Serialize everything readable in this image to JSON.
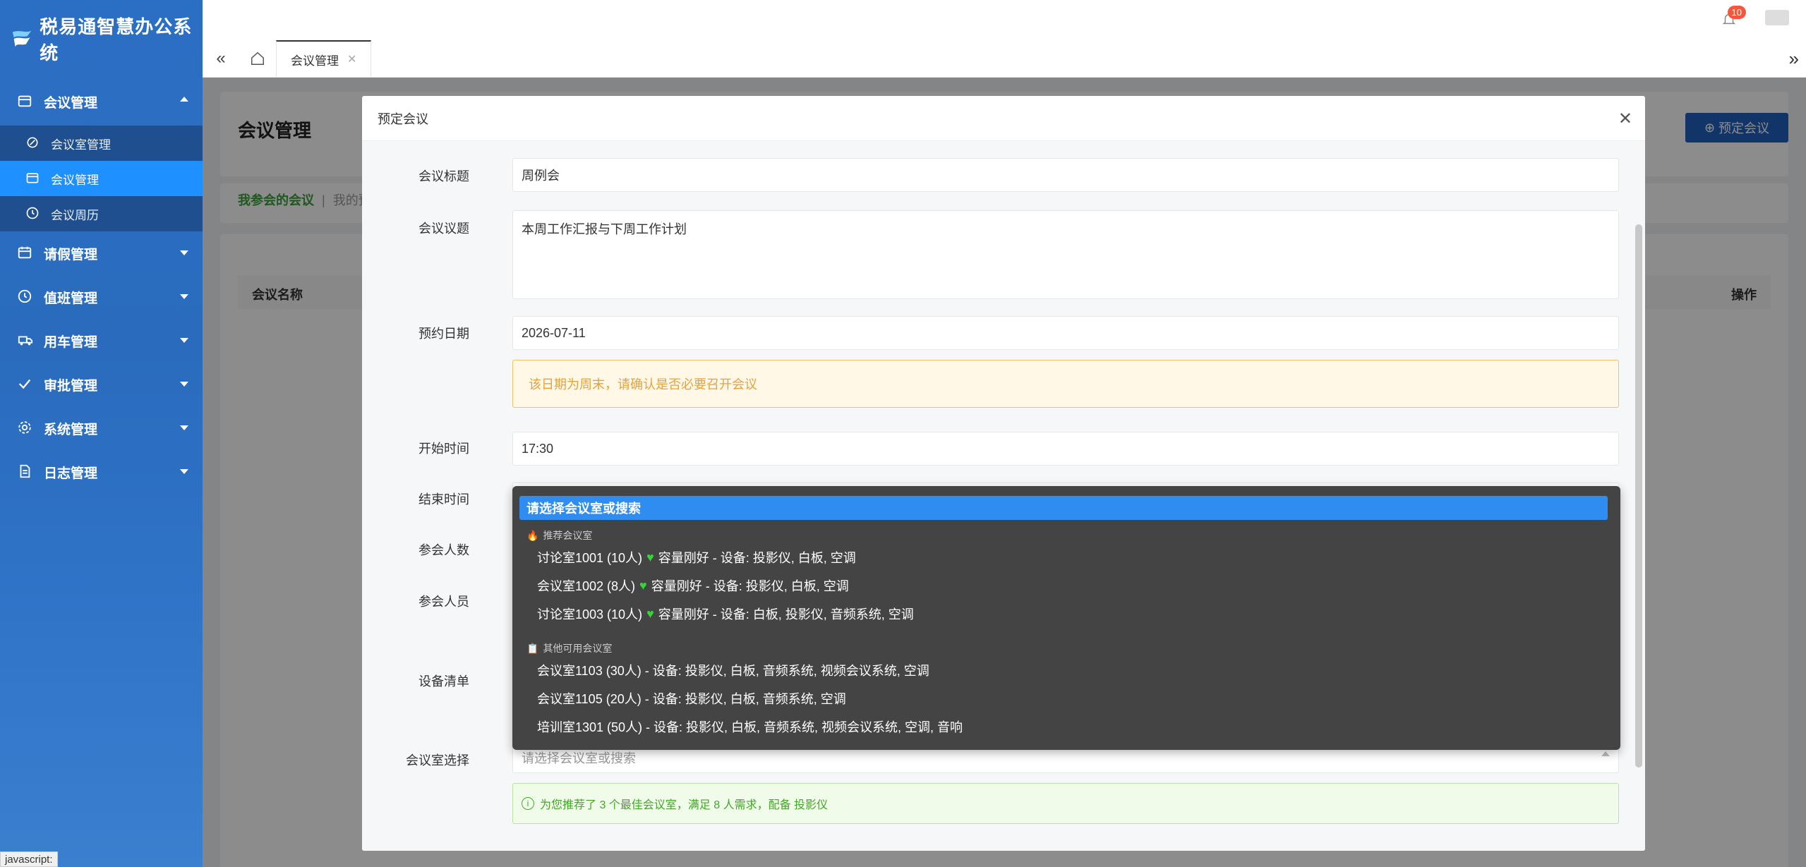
{
  "app": {
    "title": "税易通智慧办公系统"
  },
  "sidebar": {
    "groups": [
      {
        "label": "会议管理",
        "expanded": true
      },
      {
        "label": "请假管理"
      },
      {
        "label": "值班管理"
      },
      {
        "label": "用车管理"
      },
      {
        "label": "审批管理"
      },
      {
        "label": "系统管理"
      },
      {
        "label": "日志管理"
      }
    ],
    "meeting_sub": [
      {
        "label": "会议室管理"
      },
      {
        "label": "会议管理",
        "active": true
      },
      {
        "label": "会议周历"
      }
    ]
  },
  "header": {
    "tab_label": "会议管理",
    "notification_count": "10"
  },
  "page": {
    "title": "会议管理",
    "book_button": "预定会议",
    "filter_active": "我参会的会议",
    "filter_sep": "|",
    "filter_other": "我的预",
    "col_name": "会议名称",
    "col_action": "操作"
  },
  "modal": {
    "title": "预定会议",
    "fields": {
      "title_label": "会议标题",
      "title_value": "周例会",
      "topic_label": "会议议题",
      "topic_value": "本周工作汇报与下周工作计划",
      "date_label": "预约日期",
      "date_value": "2026-07-11",
      "weekend_warning": "该日期为周末，请确认是否必要召开会议",
      "start_label": "开始时间",
      "start_value": "17:30",
      "end_label": "结束时间",
      "count_label": "参会人数",
      "people_label": "参会人员",
      "equip_label": "设备清单",
      "room_label": "会议室选择",
      "room_placeholder": "请选择会议室或搜索",
      "recommend_info": "为您推荐了 3 个最佳会议室，满足 8 人需求，配备 投影仪"
    },
    "dropdown": {
      "highlighted": "请选择会议室或搜索",
      "group_recommended": "推荐会议室",
      "group_other": "其他可用会议室",
      "recommended": [
        {
          "name": "讨论室1001 (10人)",
          "fit": "容量刚好",
          "equip": "- 设备: 投影仪, 白板, 空调"
        },
        {
          "name": "会议室1002 (8人)",
          "fit": "容量刚好",
          "equip": "- 设备: 投影仪, 白板, 空调"
        },
        {
          "name": "讨论室1003 (10人)",
          "fit": "容量刚好",
          "equip": "- 设备: 白板, 投影仪, 音频系统, 空调"
        }
      ],
      "others": [
        {
          "text": "会议室1103 (30人) - 设备: 投影仪, 白板, 音频系统, 视频会议系统, 空调"
        },
        {
          "text": "会议室1105 (20人) - 设备: 投影仪, 白板, 音频系统, 空调"
        },
        {
          "text": "培训室1301 (50人) - 设备: 投影仪, 白板, 音频系统, 视频会议系统, 空调, 音响"
        }
      ]
    }
  },
  "statusbar": {
    "text": "javascript:"
  }
}
